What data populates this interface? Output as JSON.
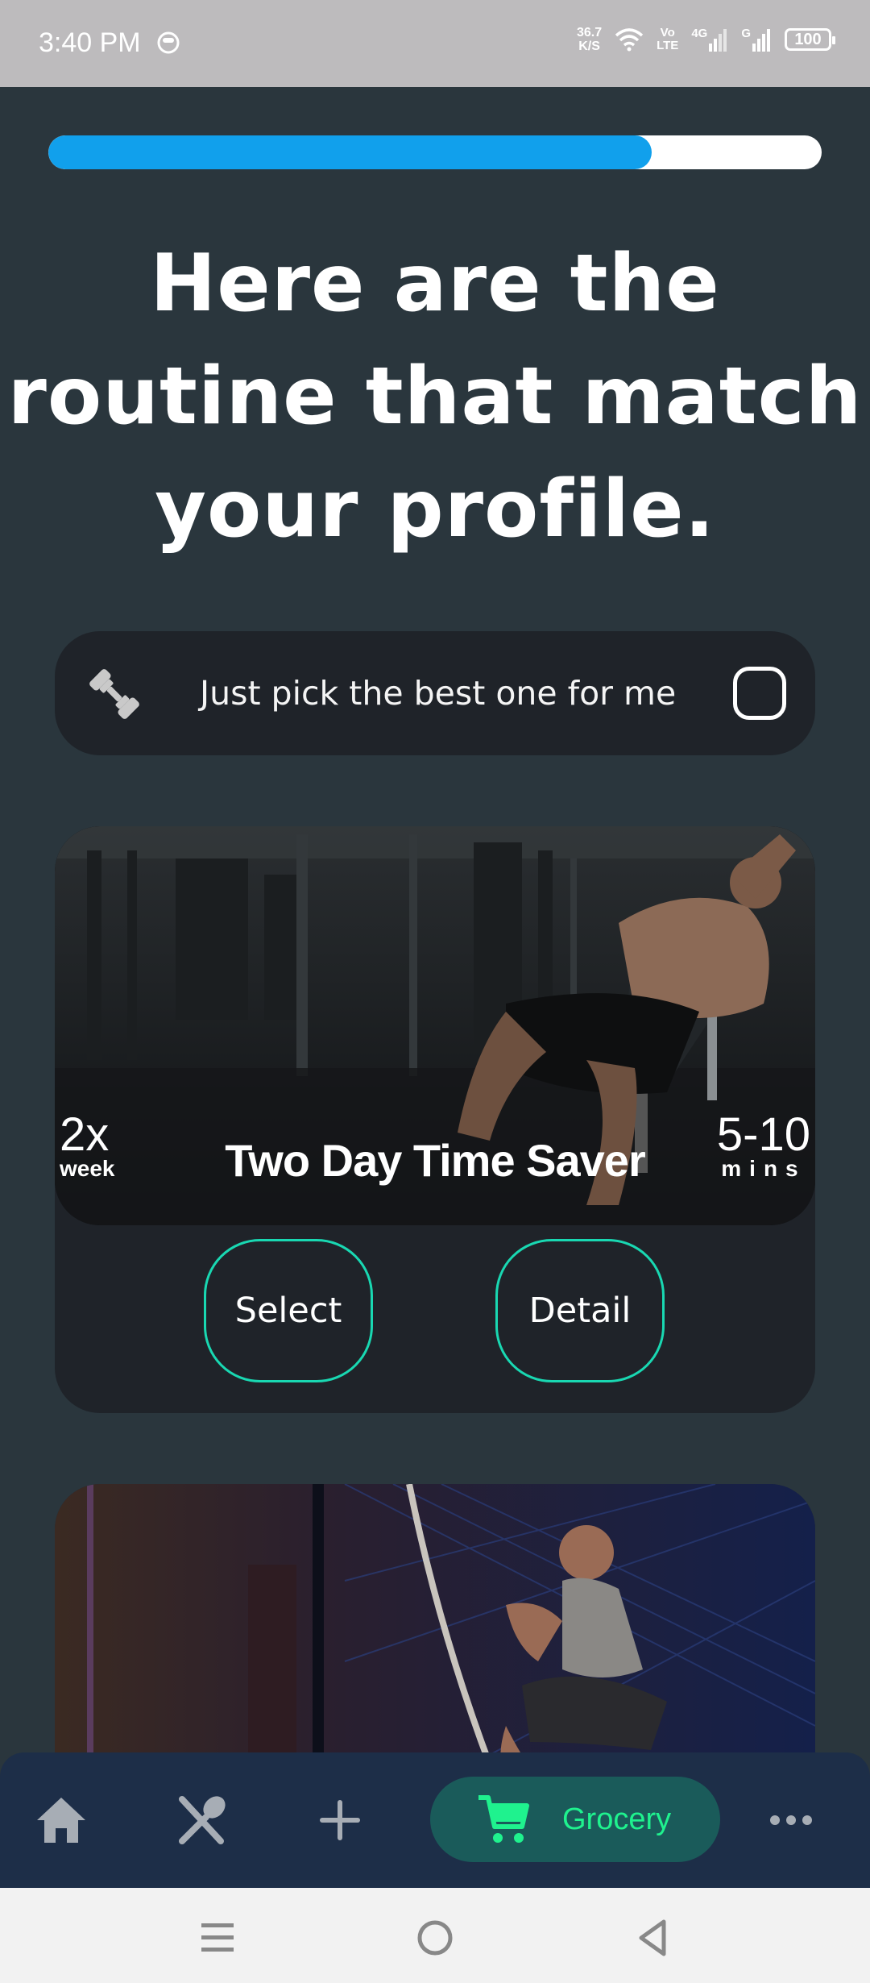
{
  "status_bar": {
    "time": "3:40 PM",
    "net_speed_value": "36.7",
    "net_speed_unit": "K/S",
    "volte_top": "Vo",
    "volte_bottom": "LTE",
    "network_4g": "4G",
    "network_g": "G",
    "battery": "100"
  },
  "progress": {
    "value_fraction": 0.78,
    "fill_color": "#11a0ec"
  },
  "headline": "Here are the routine that match your profile.",
  "pick_option": {
    "label": "Just pick the best one for me",
    "checked": false,
    "icon": "dumbbell-icon"
  },
  "routine_card": {
    "frequency_value": "2x",
    "frequency_unit": "week",
    "title": "Two Day Time Saver",
    "duration_value": "5-10",
    "duration_unit": "mins",
    "select_label": "Select",
    "detail_label": "Detail",
    "accent_color": "#19d8b2"
  },
  "bottom_nav": {
    "items": [
      "home-icon",
      "utensils-icon",
      "plus-icon",
      "cart-icon",
      "more-icon"
    ],
    "grocery_label": "Grocery",
    "grocery_color": "#1ff28e"
  },
  "system_nav": [
    "menu-icon",
    "home-circle-icon",
    "back-triangle-icon"
  ]
}
